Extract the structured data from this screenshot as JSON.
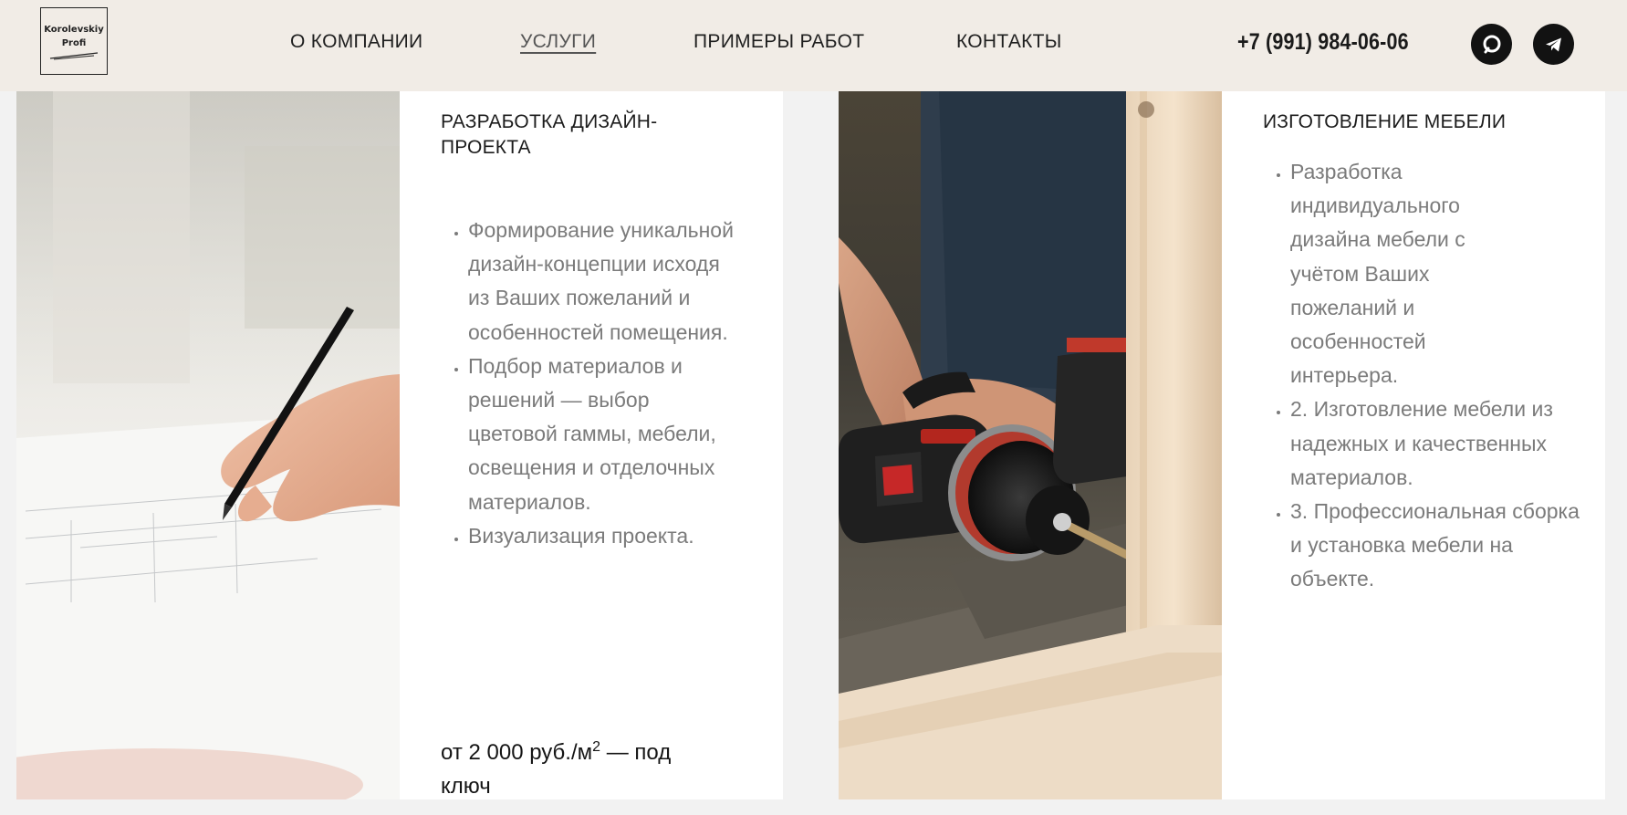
{
  "header": {
    "logo": {
      "line1": "Korolevskiy",
      "line2": "Profi"
    },
    "nav": [
      {
        "label": "О КОМПАНИИ"
      },
      {
        "label": "УСЛУГИ",
        "active": true
      },
      {
        "label": "ПРИМЕРЫ РАБОТ"
      },
      {
        "label": "КОНТАКТЫ"
      }
    ],
    "phone": "+7 (991) 984-06-06",
    "social": [
      {
        "icon": "chat-icon"
      },
      {
        "icon": "telegram-icon"
      }
    ]
  },
  "services": [
    {
      "title": "РАЗРАБОТКА ДИЗАЙН-ПРОЕКТА",
      "title_lines": [
        "РАЗРАБОТКА ДИЗАЙН-",
        "ПРОЕКТА"
      ],
      "image": "hand-drawing-plan-image",
      "items": [
        "Формирование уникальной дизайн-концепции исходя из Ваших пожеланий и особенностей помещения.",
        "Подбор материалов и решений — выбор цветовой гаммы, мебели, освещения и отделочных материалов.",
        "Визуализация проекта."
      ],
      "price": {
        "prefix": "от 2 000 руб./м",
        "sup": "2",
        "suffix": " — под",
        "line2": "ключ"
      }
    },
    {
      "title": "ИЗГОТОВЛЕНИЕ МЕБЕЛИ",
      "image": "drill-assembly-image",
      "items": [
        "Разработка индивидуального дизайна мебели с учётом Ваших пожеланий и особенностей интерьера.",
        "2. Изготовление мебели из надежных и качественных материалов.",
        "3. Профессиональная сборка и установка мебели на объекте."
      ]
    }
  ],
  "colors": {
    "header_bg": "#f1ece6",
    "page_bg": "#f2f2f2",
    "card_bg": "#ffffff",
    "body_text": "#7b7b7b",
    "heading_text": "#1c1c1c"
  }
}
